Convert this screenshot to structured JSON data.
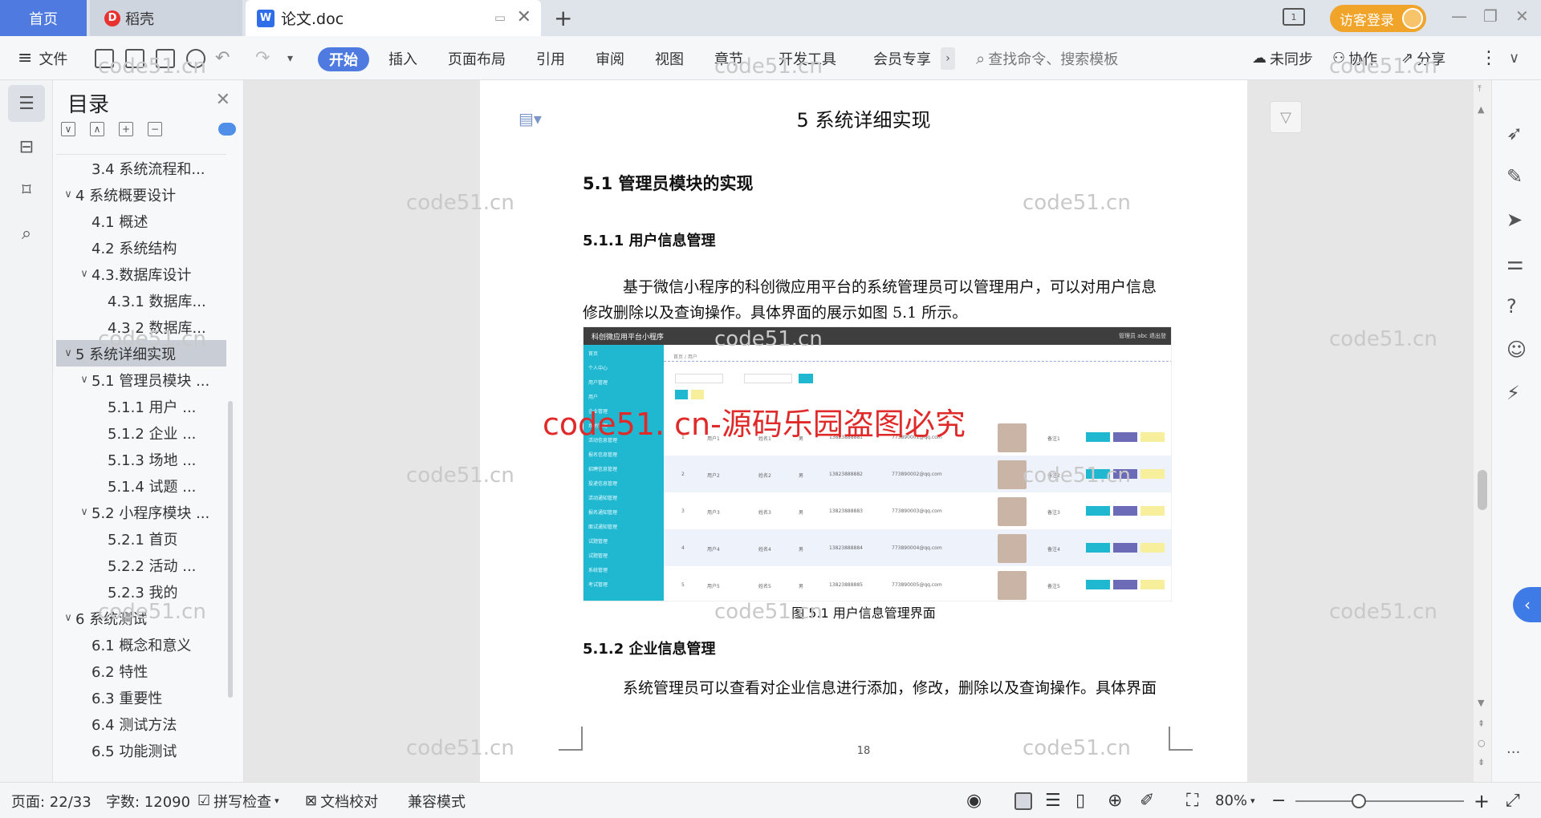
{
  "tabs": {
    "home": "首页",
    "daoke": "稻壳",
    "doc": "论文.doc"
  },
  "header": {
    "guest_login": "访客登录"
  },
  "toolbar": {
    "file": "文件",
    "items": [
      "开始",
      "插入",
      "页面布局",
      "引用",
      "审阅",
      "视图",
      "章节",
      "开发工具",
      "会员专享"
    ],
    "search_placeholder": "查找命令、搜索模板",
    "sync": "未同步",
    "collab": "协作",
    "share": "分享"
  },
  "toc": {
    "title": "目录",
    "items": [
      {
        "label": "3.4 系统流程和...",
        "level": 2,
        "caret": ""
      },
      {
        "label": "4 系统概要设计",
        "level": 1,
        "caret": "∨"
      },
      {
        "label": "4.1 概述",
        "level": 2,
        "caret": ""
      },
      {
        "label": "4.2 系统结构",
        "level": 2,
        "caret": ""
      },
      {
        "label": "4.3.数据库设计",
        "level": 2,
        "caret": "∨"
      },
      {
        "label": "4.3.1 数据库...",
        "level": 3,
        "caret": ""
      },
      {
        "label": "4.3.2 数据库...",
        "level": 3,
        "caret": ""
      },
      {
        "label": "5 系统详细实现",
        "level": 1,
        "caret": "∨",
        "selected": true
      },
      {
        "label": "5.1  管理员模块 ...",
        "level": 2,
        "caret": "∨"
      },
      {
        "label": "5.1.1  用户 ...",
        "level": 3,
        "caret": ""
      },
      {
        "label": "5.1.2  企业 ...",
        "level": 3,
        "caret": ""
      },
      {
        "label": "5.1.3  场地 ...",
        "level": 3,
        "caret": ""
      },
      {
        "label": "5.1.4  试题 ...",
        "level": 3,
        "caret": ""
      },
      {
        "label": "5.2  小程序模块 ...",
        "level": 2,
        "caret": "∨"
      },
      {
        "label": "5.2.1  首页",
        "level": 3,
        "caret": ""
      },
      {
        "label": "5.2.2  活动 ...",
        "level": 3,
        "caret": ""
      },
      {
        "label": "5.2.3  我的",
        "level": 3,
        "caret": ""
      },
      {
        "label": "6 系统测试",
        "level": 1,
        "caret": "∨"
      },
      {
        "label": "6.1 概念和意义",
        "level": 2,
        "caret": ""
      },
      {
        "label": "6.2 特性",
        "level": 2,
        "caret": ""
      },
      {
        "label": "6.3 重要性",
        "level": 2,
        "caret": ""
      },
      {
        "label": "6.4 测试方法",
        "level": 2,
        "caret": ""
      },
      {
        "label": "6.5  功能测试",
        "level": 2,
        "caret": ""
      }
    ]
  },
  "doc": {
    "chapter": "5 系统详细实现",
    "h1": "5.1  管理员模块的实现",
    "h2a": "5.1.1  用户信息管理",
    "para1_l1": "基于微信小程序的科创微应用平台的系统管理员可以管理用户，可以对用户信息",
    "para1_l2": "修改删除以及查询操作。具体界面的展示如图 5.1 所示。",
    "caption": "图 5.1  用户信息管理界面",
    "h2b": "5.1.2  企业信息管理",
    "para2_l1": "系统管理员可以查看对企业信息进行添加，修改，删除以及查询操作。具体界面",
    "page_number": "18",
    "figure": {
      "app_title": "科创微应用平台小程序",
      "top_right": "管理员 abc    退出登",
      "side_items": [
        "首页",
        "个人中心",
        "用户管理",
        "用户",
        "企业管理",
        "场地管理",
        "活动信息管理",
        "报名信息管理",
        "招聘信息管理",
        "投递信息管理",
        "活动通知管理",
        "报名通知管理",
        "面试通知管理",
        "试题管理",
        "试题管理",
        "系统管理",
        "考试管理"
      ],
      "rows": [
        {
          "no": "1",
          "user": "用户1",
          "name": "姓名1",
          "sex": "男",
          "phone": "13823888881",
          "mail": "773890001@qq.com",
          "note": "备注1"
        },
        {
          "no": "2",
          "user": "用户2",
          "name": "姓名2",
          "sex": "男",
          "phone": "13823888882",
          "mail": "773890002@qq.com",
          "note": "备注2"
        },
        {
          "no": "3",
          "user": "用户3",
          "name": "姓名3",
          "sex": "男",
          "phone": "13823888883",
          "mail": "773890003@qq.com",
          "note": "备注3"
        },
        {
          "no": "4",
          "user": "用户4",
          "name": "姓名4",
          "sex": "男",
          "phone": "13823888884",
          "mail": "773890004@qq.com",
          "note": "备注4"
        },
        {
          "no": "5",
          "user": "用户5",
          "name": "姓名5",
          "sex": "男",
          "phone": "13823888885",
          "mail": "773890005@qq.com",
          "note": "备注5"
        }
      ]
    }
  },
  "watermarks": {
    "gray": "code51.cn",
    "red": "code51. cn-源码乐园盗图必究"
  },
  "status": {
    "page": "页面: 22/33",
    "words": "字数: 12090",
    "spell": "拼写检查",
    "proof": "文档校对",
    "compat": "兼容模式",
    "zoom": "80%"
  }
}
